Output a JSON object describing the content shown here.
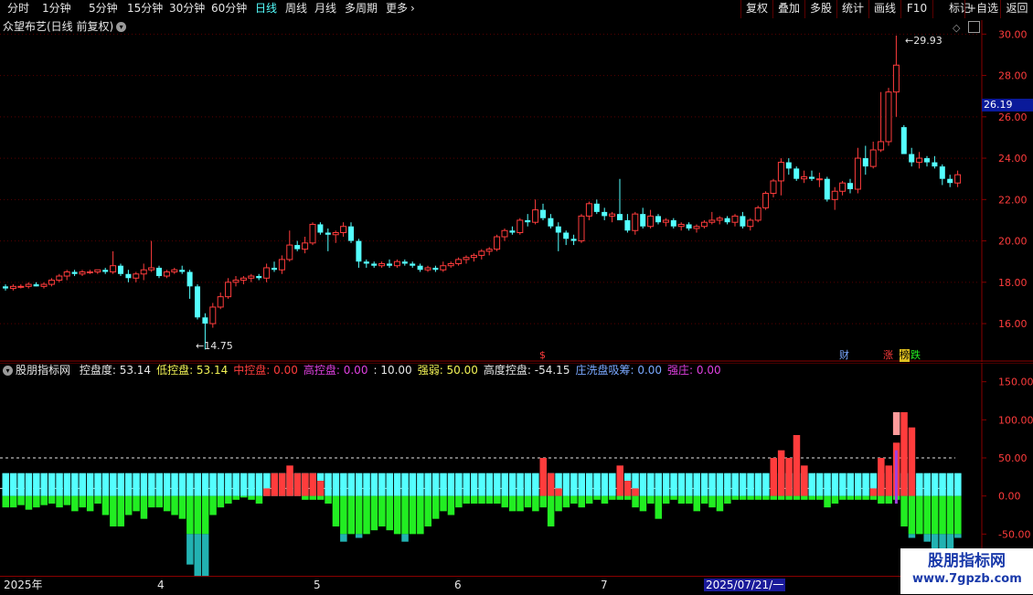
{
  "toolbar": {
    "periods": [
      "分时",
      "1分钟",
      "5分钟",
      "15分钟",
      "30分钟",
      "60分钟",
      "日线",
      "周线",
      "月线",
      "多周期",
      "更多"
    ],
    "more_chevron": "chevron-right-icon",
    "actions": [
      "复权",
      "叠加",
      "多股",
      "统计",
      "画线",
      "F10",
      "+自选",
      "返回",
      "标记"
    ]
  },
  "main_panel": {
    "title": "众望布艺(日线 前复权)",
    "menu_icon": "chevron-down-icon",
    "icons": [
      "diamond-icon",
      "window-icon"
    ],
    "y_ticks": [
      "30.00",
      "28.00",
      "26.00",
      "24.00",
      "22.00",
      "20.00",
      "18.00",
      "16.00"
    ],
    "price_tag": "26.19",
    "high_label": "29.93",
    "low_label": "14.75",
    "markers": {
      "finance": "财",
      "limit_up": "涨",
      "dragon_tiger": "榜",
      "limit_down": "跌",
      "special": "$"
    }
  },
  "indicator_panel": {
    "name": "股朋指标网",
    "params": [
      {
        "label": "控盘度:",
        "value": "53.14",
        "color": "#e6e6e6"
      },
      {
        "label": "低控盘:",
        "value": "53.14",
        "color": "#f2f255"
      },
      {
        "label": "中控盘:",
        "value": "0.00",
        "color": "#ff3c3c"
      },
      {
        "label": "高控盘:",
        "value": "0.00",
        "color": "#e040e0"
      },
      {
        "label": ":",
        "value": "10.00",
        "color": "#e6e6e6"
      },
      {
        "label": "强弱:",
        "value": "50.00",
        "color": "#f2f255"
      },
      {
        "label": "高度控盘:",
        "value": "-54.15",
        "color": "#e6e6e6"
      },
      {
        "label": "庄洗盘吸筹:",
        "value": "0.00",
        "color": "#7aa8ff"
      },
      {
        "label": "强庄:",
        "value": "0.00",
        "color": "#e040e0"
      }
    ],
    "y_ticks": [
      "150.00",
      "100.00",
      "50.00",
      "0.00",
      "-50.00"
    ]
  },
  "time_axis": [
    "2025年",
    "4",
    "5",
    "6",
    "7",
    "2025/07/21/一"
  ],
  "watermark": {
    "name": "股朋指标网",
    "url": "www.7gpzb.com"
  },
  "colors": {
    "up": "#ff3c3c",
    "down": "#54ffff",
    "grid": "#5a0000",
    "green": "#22ee22",
    "yellow": "#f2f255",
    "purple": "#a040e0"
  },
  "chart_data": {
    "type": "candlestick",
    "price_ylim": [
      14.5,
      30.5
    ],
    "candles": [
      [
        17.8,
        17.9,
        17.6,
        17.7
      ],
      [
        17.7,
        17.9,
        17.6,
        17.8
      ],
      [
        17.8,
        17.9,
        17.7,
        17.8
      ],
      [
        17.8,
        18.0,
        17.7,
        17.9
      ],
      [
        17.9,
        18.0,
        17.8,
        17.8
      ],
      [
        17.8,
        18.0,
        17.7,
        17.9
      ],
      [
        17.9,
        18.2,
        17.8,
        18.1
      ],
      [
        18.1,
        18.4,
        18.0,
        18.3
      ],
      [
        18.3,
        18.6,
        18.1,
        18.5
      ],
      [
        18.5,
        18.6,
        18.3,
        18.4
      ],
      [
        18.4,
        18.6,
        18.3,
        18.5
      ],
      [
        18.5,
        18.6,
        18.4,
        18.5
      ],
      [
        18.5,
        18.6,
        18.4,
        18.6
      ],
      [
        18.6,
        18.7,
        18.4,
        18.5
      ],
      [
        18.5,
        19.5,
        18.4,
        18.8
      ],
      [
        18.8,
        18.9,
        18.3,
        18.4
      ],
      [
        18.4,
        18.6,
        18.0,
        18.2
      ],
      [
        18.2,
        18.5,
        18.0,
        18.4
      ],
      [
        18.4,
        18.9,
        18.1,
        18.6
      ],
      [
        18.6,
        20.0,
        18.5,
        18.7
      ],
      [
        18.7,
        18.8,
        18.2,
        18.3
      ],
      [
        18.3,
        18.6,
        18.2,
        18.5
      ],
      [
        18.5,
        18.7,
        18.4,
        18.6
      ],
      [
        18.6,
        18.8,
        18.4,
        18.5
      ],
      [
        18.5,
        18.6,
        17.2,
        17.8
      ],
      [
        17.8,
        17.9,
        16.2,
        16.3
      ],
      [
        16.3,
        16.5,
        14.75,
        16.0
      ],
      [
        16.0,
        17.0,
        15.8,
        16.8
      ],
      [
        16.8,
        17.5,
        16.7,
        17.3
      ],
      [
        17.3,
        18.2,
        17.2,
        18.0
      ],
      [
        18.0,
        18.3,
        17.8,
        18.1
      ],
      [
        18.1,
        18.3,
        17.9,
        18.2
      ],
      [
        18.2,
        18.4,
        18.0,
        18.3
      ],
      [
        18.3,
        18.4,
        18.1,
        18.2
      ],
      [
        18.2,
        18.9,
        18.0,
        18.7
      ],
      [
        18.7,
        19.0,
        18.5,
        18.6
      ],
      [
        18.6,
        19.3,
        18.4,
        19.1
      ],
      [
        19.1,
        20.5,
        19.0,
        19.8
      ],
      [
        19.8,
        20.0,
        19.5,
        19.6
      ],
      [
        19.6,
        20.2,
        19.4,
        19.9
      ],
      [
        19.9,
        20.9,
        19.8,
        20.8
      ],
      [
        20.8,
        20.9,
        20.3,
        20.4
      ],
      [
        20.4,
        20.6,
        19.5,
        20.3
      ],
      [
        20.3,
        20.5,
        19.9,
        20.4
      ],
      [
        20.4,
        20.9,
        20.2,
        20.7
      ],
      [
        20.7,
        20.9,
        19.9,
        20.0
      ],
      [
        20.0,
        20.1,
        18.7,
        19.0
      ],
      [
        19.0,
        19.1,
        18.7,
        18.9
      ],
      [
        18.9,
        19.0,
        18.7,
        18.8
      ],
      [
        18.8,
        19.0,
        18.7,
        18.9
      ],
      [
        18.9,
        19.1,
        18.7,
        18.8
      ],
      [
        18.8,
        19.1,
        18.7,
        19.0
      ],
      [
        19.0,
        19.1,
        18.8,
        18.9
      ],
      [
        18.9,
        19.0,
        18.7,
        18.8
      ],
      [
        18.8,
        18.9,
        18.5,
        18.6
      ],
      [
        18.6,
        18.8,
        18.5,
        18.7
      ],
      [
        18.7,
        18.8,
        18.5,
        18.6
      ],
      [
        18.6,
        19.0,
        18.5,
        18.8
      ],
      [
        18.8,
        19.0,
        18.7,
        18.9
      ],
      [
        18.9,
        19.2,
        18.8,
        19.1
      ],
      [
        19.1,
        19.3,
        18.9,
        19.2
      ],
      [
        19.2,
        19.4,
        19.0,
        19.3
      ],
      [
        19.3,
        19.6,
        19.1,
        19.5
      ],
      [
        19.5,
        19.7,
        19.3,
        19.6
      ],
      [
        19.6,
        20.3,
        19.5,
        20.2
      ],
      [
        20.2,
        20.6,
        20.0,
        20.5
      ],
      [
        20.5,
        20.7,
        20.3,
        20.4
      ],
      [
        20.4,
        21.1,
        20.3,
        21.0
      ],
      [
        21.0,
        21.3,
        20.7,
        20.9
      ],
      [
        20.9,
        22.0,
        20.8,
        21.5
      ],
      [
        21.5,
        21.8,
        21.0,
        21.1
      ],
      [
        21.1,
        21.3,
        20.6,
        20.7
      ],
      [
        20.7,
        20.9,
        19.5,
        20.4
      ],
      [
        20.4,
        20.5,
        19.8,
        20.1
      ],
      [
        20.1,
        20.3,
        19.8,
        20.0
      ],
      [
        20.0,
        21.3,
        19.9,
        21.2
      ],
      [
        21.2,
        21.9,
        21.0,
        21.8
      ],
      [
        21.8,
        22.0,
        21.3,
        21.4
      ],
      [
        21.4,
        21.6,
        21.0,
        21.2
      ],
      [
        21.2,
        21.4,
        20.9,
        21.3
      ],
      [
        21.3,
        23.0,
        21.0,
        21.0
      ],
      [
        21.0,
        21.3,
        20.4,
        20.5
      ],
      [
        20.5,
        21.4,
        20.3,
        21.3
      ],
      [
        21.3,
        21.6,
        20.6,
        20.7
      ],
      [
        20.7,
        21.5,
        20.6,
        21.2
      ],
      [
        21.2,
        21.3,
        20.8,
        20.9
      ],
      [
        20.9,
        21.1,
        20.7,
        21.0
      ],
      [
        21.0,
        21.1,
        20.6,
        20.7
      ],
      [
        20.7,
        20.9,
        20.5,
        20.8
      ],
      [
        20.8,
        20.9,
        20.5,
        20.6
      ],
      [
        20.6,
        20.8,
        20.4,
        20.7
      ],
      [
        20.7,
        21.0,
        20.6,
        20.9
      ],
      [
        20.9,
        21.4,
        20.8,
        21.0
      ],
      [
        21.0,
        21.2,
        20.8,
        21.1
      ],
      [
        21.1,
        21.2,
        20.8,
        20.9
      ],
      [
        20.9,
        21.3,
        20.7,
        21.2
      ],
      [
        21.2,
        21.4,
        20.6,
        20.7
      ],
      [
        20.7,
        21.1,
        20.5,
        21.0
      ],
      [
        21.0,
        21.7,
        20.9,
        21.6
      ],
      [
        21.6,
        22.4,
        21.5,
        22.3
      ],
      [
        22.3,
        23.0,
        22.1,
        22.9
      ],
      [
        22.9,
        24.0,
        22.2,
        23.8
      ],
      [
        23.8,
        24.0,
        23.2,
        23.5
      ],
      [
        23.5,
        23.6,
        22.9,
        23.0
      ],
      [
        23.0,
        23.4,
        22.8,
        23.1
      ],
      [
        23.1,
        23.4,
        22.9,
        23.0
      ],
      [
        23.0,
        23.3,
        22.6,
        23.0
      ],
      [
        23.0,
        23.1,
        21.9,
        22.0
      ],
      [
        22.0,
        22.6,
        21.5,
        22.4
      ],
      [
        22.4,
        22.9,
        22.2,
        22.8
      ],
      [
        22.8,
        23.0,
        22.3,
        22.5
      ],
      [
        22.5,
        24.5,
        22.3,
        24.0
      ],
      [
        24.0,
        24.6,
        23.2,
        23.6
      ],
      [
        23.6,
        24.8,
        23.5,
        24.4
      ],
      [
        24.4,
        27.2,
        24.3,
        24.8
      ],
      [
        24.8,
        27.4,
        24.6,
        27.2
      ],
      [
        27.2,
        29.93,
        26.0,
        28.5
      ],
      [
        25.5,
        25.6,
        24.2,
        24.2
      ],
      [
        24.2,
        24.5,
        23.6,
        23.8
      ],
      [
        23.8,
        24.3,
        23.5,
        24.0
      ],
      [
        24.0,
        24.1,
        23.6,
        23.8
      ],
      [
        23.8,
        24.1,
        23.5,
        23.6
      ],
      [
        23.6,
        23.7,
        22.7,
        23.0
      ],
      [
        23.0,
        23.2,
        22.6,
        22.8
      ],
      [
        22.8,
        23.4,
        22.6,
        23.2
      ]
    ],
    "indicator_ylim": [
      -100,
      170
    ],
    "indicator": {
      "cyan_top": [
        30,
        30,
        30,
        30,
        30,
        30,
        30,
        30,
        30,
        30,
        30,
        30,
        30,
        30,
        30,
        30,
        30,
        30,
        30,
        30,
        30,
        30,
        30,
        30,
        30,
        30,
        30,
        30,
        30,
        30,
        30,
        30,
        30,
        30,
        30,
        30,
        30,
        30,
        30,
        30,
        30,
        30,
        30,
        30,
        30,
        30,
        30,
        30,
        30,
        30,
        30,
        30,
        30,
        30,
        30,
        30,
        30,
        30,
        30,
        30,
        30,
        30,
        30,
        30,
        30,
        30,
        30,
        30,
        30,
        30,
        30,
        30,
        30,
        30,
        30,
        30,
        30,
        30,
        30,
        30,
        30,
        30,
        30,
        30,
        30,
        30,
        30,
        30,
        30,
        30,
        30,
        30,
        30,
        30,
        30,
        30,
        30,
        30,
        30,
        30,
        30,
        30,
        30,
        30,
        30,
        30,
        30,
        30,
        30,
        30,
        30,
        30,
        30,
        30,
        30,
        30,
        30,
        30,
        30,
        30,
        30,
        30,
        30,
        30,
        30
      ],
      "red_top": [
        0,
        0,
        0,
        0,
        0,
        0,
        0,
        0,
        0,
        0,
        0,
        0,
        0,
        0,
        0,
        0,
        0,
        0,
        0,
        0,
        0,
        0,
        0,
        0,
        0,
        0,
        0,
        0,
        0,
        0,
        0,
        0,
        0,
        0,
        10,
        30,
        30,
        40,
        30,
        30,
        30,
        20,
        0,
        0,
        0,
        0,
        0,
        0,
        0,
        0,
        0,
        0,
        0,
        0,
        0,
        0,
        0,
        0,
        0,
        0,
        0,
        0,
        0,
        0,
        0,
        0,
        0,
        0,
        0,
        0,
        50,
        30,
        10,
        0,
        0,
        0,
        0,
        0,
        0,
        0,
        40,
        20,
        10,
        0,
        0,
        0,
        0,
        0,
        0,
        0,
        0,
        0,
        0,
        0,
        0,
        0,
        0,
        0,
        0,
        0,
        50,
        60,
        50,
        80,
        40,
        0,
        0,
        0,
        0,
        0,
        0,
        0,
        0,
        10,
        50,
        40,
        70,
        110,
        90,
        0,
        0,
        0,
        0,
        0,
        0
      ],
      "green_bottom": [
        -15,
        -15,
        -12,
        -18,
        -15,
        -12,
        -10,
        -15,
        -12,
        -20,
        -15,
        -20,
        -10,
        -25,
        -40,
        -40,
        -25,
        -20,
        -30,
        -15,
        -15,
        -20,
        -25,
        -30,
        -90,
        -110,
        -110,
        -25,
        -15,
        -10,
        -5,
        -2,
        -5,
        -10,
        0,
        0,
        0,
        0,
        0,
        -5,
        -5,
        -5,
        -10,
        -40,
        -60,
        -50,
        -55,
        -50,
        -45,
        -40,
        -45,
        -50,
        -60,
        -50,
        -50,
        -40,
        -30,
        -20,
        -25,
        -15,
        -10,
        -10,
        -10,
        -10,
        -10,
        -15,
        -20,
        -20,
        -15,
        -20,
        -15,
        -40,
        -20,
        -15,
        -10,
        -15,
        -10,
        -5,
        -10,
        -5,
        -5,
        -5,
        -15,
        -20,
        -10,
        -30,
        -10,
        -5,
        -10,
        -10,
        -20,
        -10,
        -15,
        -20,
        -10,
        -5,
        -5,
        -5,
        -5,
        -5,
        -5,
        -5,
        -5,
        -5,
        -5,
        -5,
        -5,
        -15,
        -10,
        -5,
        -5,
        -5,
        -5,
        -5,
        -10,
        -10,
        -5,
        -40,
        -55,
        -50,
        -60,
        -70,
        -75,
        -70,
        -55
      ]
    }
  }
}
